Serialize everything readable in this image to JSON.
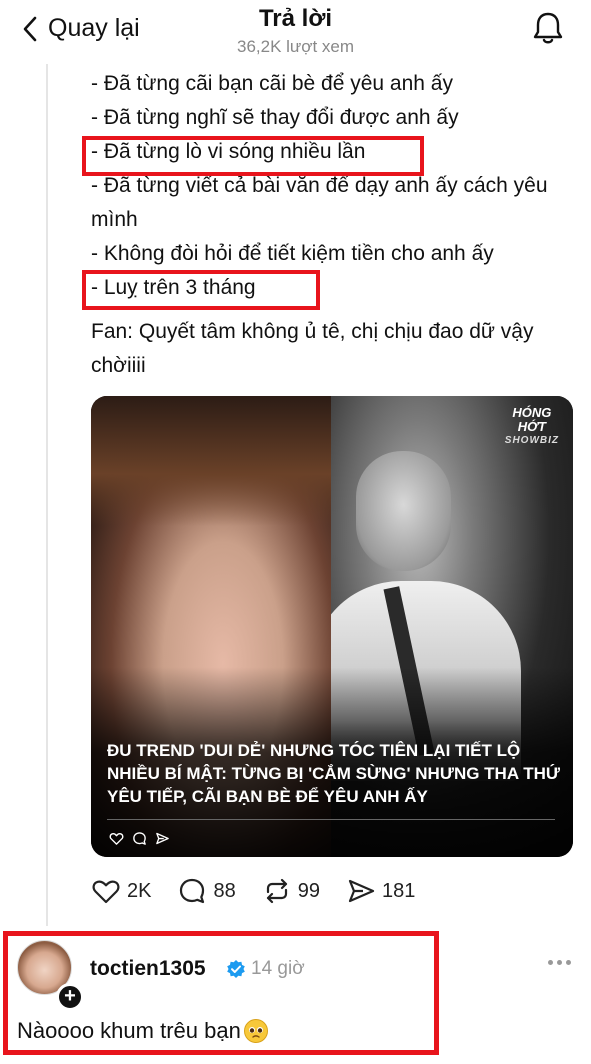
{
  "header": {
    "back_label": "Quay lại",
    "title": "Trả lời",
    "views": "36,2K lượt xem"
  },
  "post": {
    "lines": [
      "- Đã từng cãi bạn cãi bè để yêu anh ấy",
      "- Đã từng nghĩ sẽ thay đổi được anh ấy",
      "- Đã từng lò vi sóng nhiều lần",
      "- Đã từng viết cả bài văn để dạy anh ấy cách yêu mình",
      "- Không đòi hỏi để tiết kiệm tiền cho anh ấy",
      "- Luỵ trên 3 tháng"
    ],
    "fan_note": "Fan: Quyết tâm không ủ tê, chị chịu đao dữ vậy chờiiii",
    "highlight_color": "#e8141c"
  },
  "media": {
    "brand_top": "HÓNG",
    "brand_mid": "HỚT",
    "brand_sub": "SHOWBIZ",
    "headline": "ĐU TREND 'DUI DẺ' NHƯNG TÓC TIÊN LẠI TIẾT LỘ NHIỀU BÍ MẬT: TỪNG BỊ 'CẮM SỪNG' NHƯNG THA THỨ YÊU TIẾP, CÃI BẠN BÈ ĐỂ YÊU ANH ẤY"
  },
  "actions": {
    "likes": "2K",
    "comments": "88",
    "reposts": "99",
    "shares": "181"
  },
  "reply": {
    "username": "toctien1305",
    "time": "14 giờ",
    "text": "Nàoooo khum trêu bạn",
    "verified_color": "#1d9bf0"
  }
}
